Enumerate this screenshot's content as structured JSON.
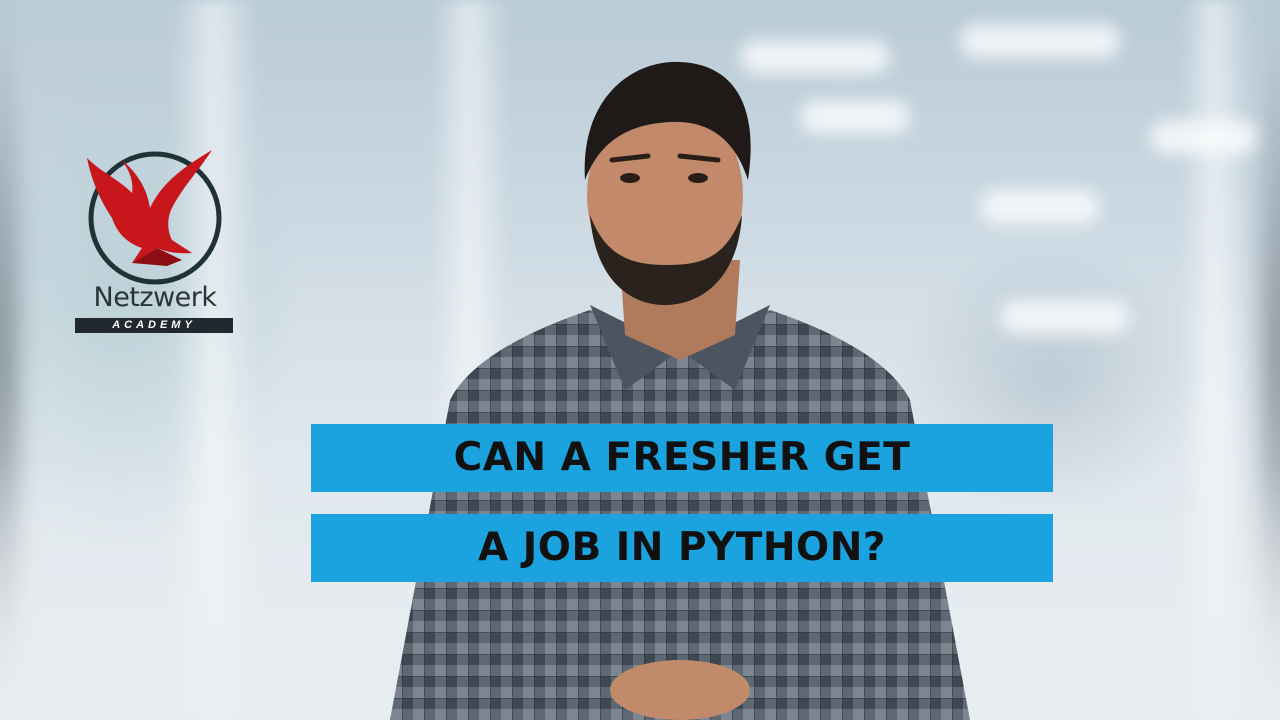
{
  "brand": {
    "name": "Netzwerk",
    "tagline": "ACADEMY",
    "logo_icon": "eagle-icon",
    "logo_color": "#c8161d",
    "ring_color": "#1f3236"
  },
  "caption": {
    "line1": "CAN A FRESHER GET",
    "line2": "A JOB IN PYTHON?",
    "band_color": "#1ba3df",
    "text_color": "#111111"
  }
}
